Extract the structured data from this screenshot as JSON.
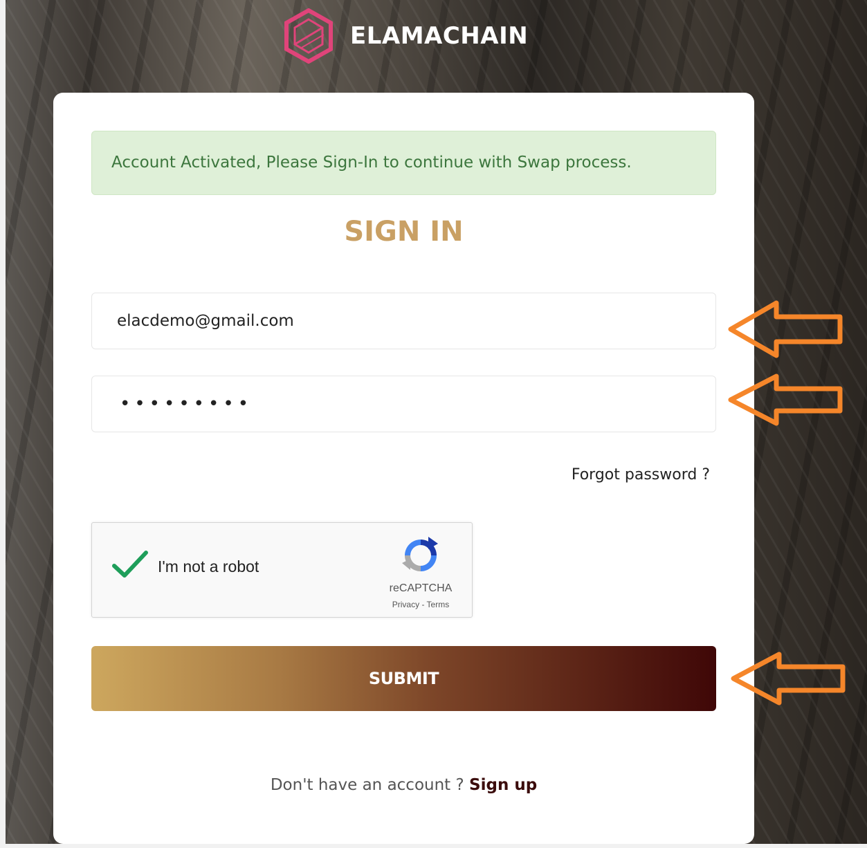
{
  "brand": {
    "name": "ELAMACHAIN",
    "logo_color": "#e0447a"
  },
  "alert": {
    "message": "Account Activated, Please Sign-In to continue with Swap process."
  },
  "form": {
    "title": "SIGN IN",
    "email_value": "elacdemo@gmail.com",
    "password_value": "•••••••••",
    "forgot_label": "Forgot password ?",
    "submit_label": "SUBMIT"
  },
  "captcha": {
    "label": "I'm not a robot",
    "brand": "reCAPTCHA",
    "links": "Privacy - Terms",
    "checked": true
  },
  "signup": {
    "prompt": "Don't have an account ?",
    "link_label": "Sign up"
  },
  "colors": {
    "accent_title": "#c9a064",
    "alert_bg": "#dff0d8",
    "alert_text": "#3c763d",
    "annotation_arrow": "#f5862a"
  },
  "annotations": {
    "arrow_icon": "left-arrow-icon",
    "count": 3
  }
}
